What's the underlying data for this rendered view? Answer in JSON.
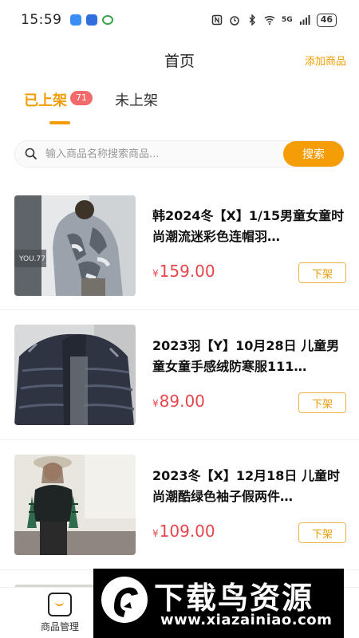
{
  "status_bar": {
    "time": "15:59",
    "battery": "46",
    "network": "5G"
  },
  "header": {
    "title": "首页",
    "add_label": "添加商品"
  },
  "tabs": [
    {
      "label": "已上架",
      "count": "71",
      "active": true
    },
    {
      "label": "未上架",
      "active": false
    }
  ],
  "search": {
    "placeholder": "输入商品名称搜索商品...",
    "button": "搜索"
  },
  "products": [
    {
      "title": "韩2024冬【X】1/15男童女童时尚潮流迷彩色连帽羽…",
      "currency": "¥",
      "price": "159.00",
      "action": "下架",
      "image_caption": "YOU.77"
    },
    {
      "title": "2023羽【Y】10月28日 儿童男童女童手感绒防寒服111…",
      "currency": "¥",
      "price": "89.00",
      "action": "下架"
    },
    {
      "title": "2023冬【X】12月18日 儿童时尚潮酷绿色袖子假两件…",
      "currency": "¥",
      "price": "109.00",
      "action": "下架"
    }
  ],
  "tabbar": {
    "items": [
      {
        "label": "商品管理",
        "active": true
      }
    ]
  },
  "watermark": {
    "title": "下载鸟资源",
    "url": "www.xiazainiao.com"
  },
  "colors": {
    "accent": "#f29c00",
    "price": "#e5464d",
    "badge": "#f26a6a"
  }
}
